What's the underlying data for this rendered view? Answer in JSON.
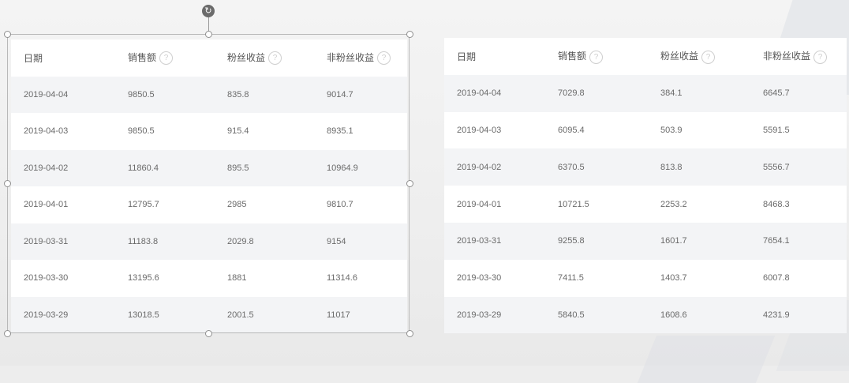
{
  "left_table": {
    "headers": [
      {
        "label": "日期",
        "help": false
      },
      {
        "label": "销售额",
        "help": true
      },
      {
        "label": "粉丝收益",
        "help": true
      },
      {
        "label": "非粉丝收益",
        "help": true
      }
    ],
    "rows": [
      [
        "2019-04-04",
        "9850.5",
        "835.8",
        "9014.7"
      ],
      [
        "2019-04-03",
        "9850.5",
        "915.4",
        "8935.1"
      ],
      [
        "2019-04-02",
        "11860.4",
        "895.5",
        "10964.9"
      ],
      [
        "2019-04-01",
        "12795.7",
        "2985",
        "9810.7"
      ],
      [
        "2019-03-31",
        "11183.8",
        "2029.8",
        "9154"
      ],
      [
        "2019-03-30",
        "13195.6",
        "1881",
        "11314.6"
      ],
      [
        "2019-03-29",
        "13018.5",
        "2001.5",
        "11017"
      ]
    ]
  },
  "right_table": {
    "headers": [
      {
        "label": "日期",
        "help": false
      },
      {
        "label": "销售额",
        "help": true
      },
      {
        "label": "粉丝收益",
        "help": true
      },
      {
        "label": "非粉丝收益",
        "help": true
      }
    ],
    "rows": [
      [
        "2019-04-04",
        "7029.8",
        "384.1",
        "6645.7"
      ],
      [
        "2019-04-03",
        "6095.4",
        "503.9",
        "5591.5"
      ],
      [
        "2019-04-02",
        "6370.5",
        "813.8",
        "5556.7"
      ],
      [
        "2019-04-01",
        "10721.5",
        "2253.2",
        "8468.3"
      ],
      [
        "2019-03-31",
        "9255.8",
        "1601.7",
        "7654.1"
      ],
      [
        "2019-03-30",
        "7411.5",
        "1403.7",
        "6007.8"
      ],
      [
        "2019-03-29",
        "5840.5",
        "1608.6",
        "4231.9"
      ]
    ]
  },
  "icons": {
    "help": "question-circle-icon",
    "rotate": "rotate-handle-icon"
  },
  "colors": {
    "row_alt": "#f3f4f6",
    "selection": "#b8b8b8"
  }
}
